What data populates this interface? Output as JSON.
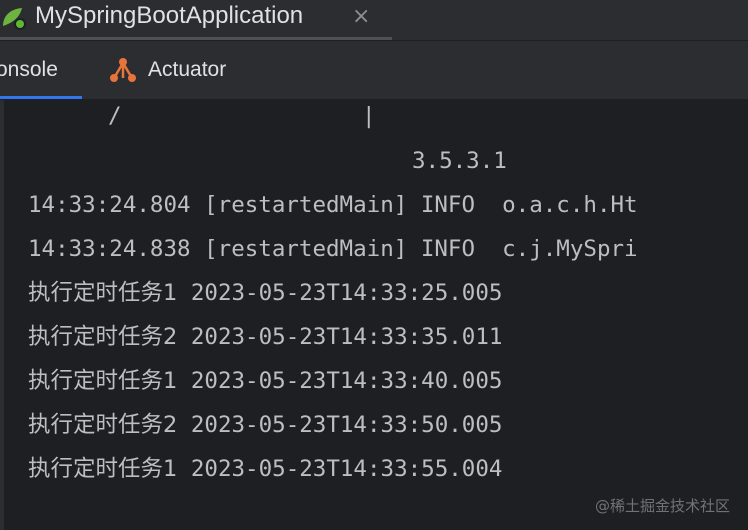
{
  "window": {
    "title": "MySpringBootApplication",
    "close_glyph": "×"
  },
  "tabs": [
    {
      "label": "onsole",
      "selected": true
    },
    {
      "label": "Actuator",
      "selected": false,
      "icon": "actuator-icon"
    }
  ],
  "console": {
    "banner_fragments": [
      "/",
      "|"
    ],
    "version": "3.5.3.1",
    "log_lines": [
      "14:33:24.804 [restartedMain] INFO  o.a.c.h.Ht",
      "14:33:24.838 [restartedMain] INFO  c.j.MySpri"
    ],
    "task_lines": [
      {
        "prefix": "执行定时任务1",
        "time": "2023-05-23T14:33:25.005"
      },
      {
        "prefix": "执行定时任务2",
        "time": "2023-05-23T14:33:35.011"
      },
      {
        "prefix": "执行定时任务1",
        "time": "2023-05-23T14:33:40.005"
      },
      {
        "prefix": "执行定时任务2",
        "time": "2023-05-23T14:33:50.005"
      },
      {
        "prefix": "执行定时任务1",
        "time": "2023-05-23T14:33:55.004"
      }
    ]
  },
  "watermark": "@稀土掘金技术社区",
  "colors": {
    "background": "#2b2d30",
    "console_bg": "#1e1f22",
    "text": "#bcbec4",
    "accent": "#3574f0"
  }
}
